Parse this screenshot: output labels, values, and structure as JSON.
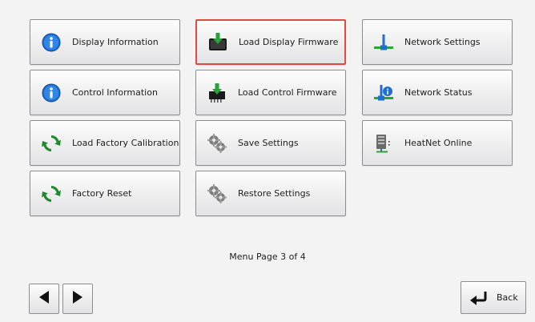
{
  "menu": {
    "buttons": [
      {
        "label": "Display Information",
        "icon": "info-icon"
      },
      {
        "label": "Load Display Firmware",
        "icon": "download-display-icon",
        "selected": true
      },
      {
        "label": "Network Settings",
        "icon": "network-icon"
      },
      {
        "label": "Control Information",
        "icon": "info-icon"
      },
      {
        "label": "Load Control Firmware",
        "icon": "download-chip-icon"
      },
      {
        "label": "Network Status",
        "icon": "network-status-icon"
      },
      {
        "label": "Load Factory Calibration",
        "icon": "refresh-icon"
      },
      {
        "label": "Save Settings",
        "icon": "gears-icon"
      },
      {
        "label": "HeatNet Online",
        "icon": "server-icon"
      },
      {
        "label": "Factory Reset",
        "icon": "refresh-icon"
      },
      {
        "label": "Restore Settings",
        "icon": "gears-icon"
      }
    ]
  },
  "footer": {
    "page_indicator": "Menu Page 3 of 4",
    "prev_icon": "triangle-left-icon",
    "next_icon": "triangle-right-icon",
    "back_label": "Back",
    "back_icon": "return-arrow-icon"
  },
  "colors": {
    "selected_border": "#df4a45",
    "info_blue": "#1565c0",
    "refresh_green": "#1f8a2c",
    "arrow_green": "#2aa13a"
  }
}
